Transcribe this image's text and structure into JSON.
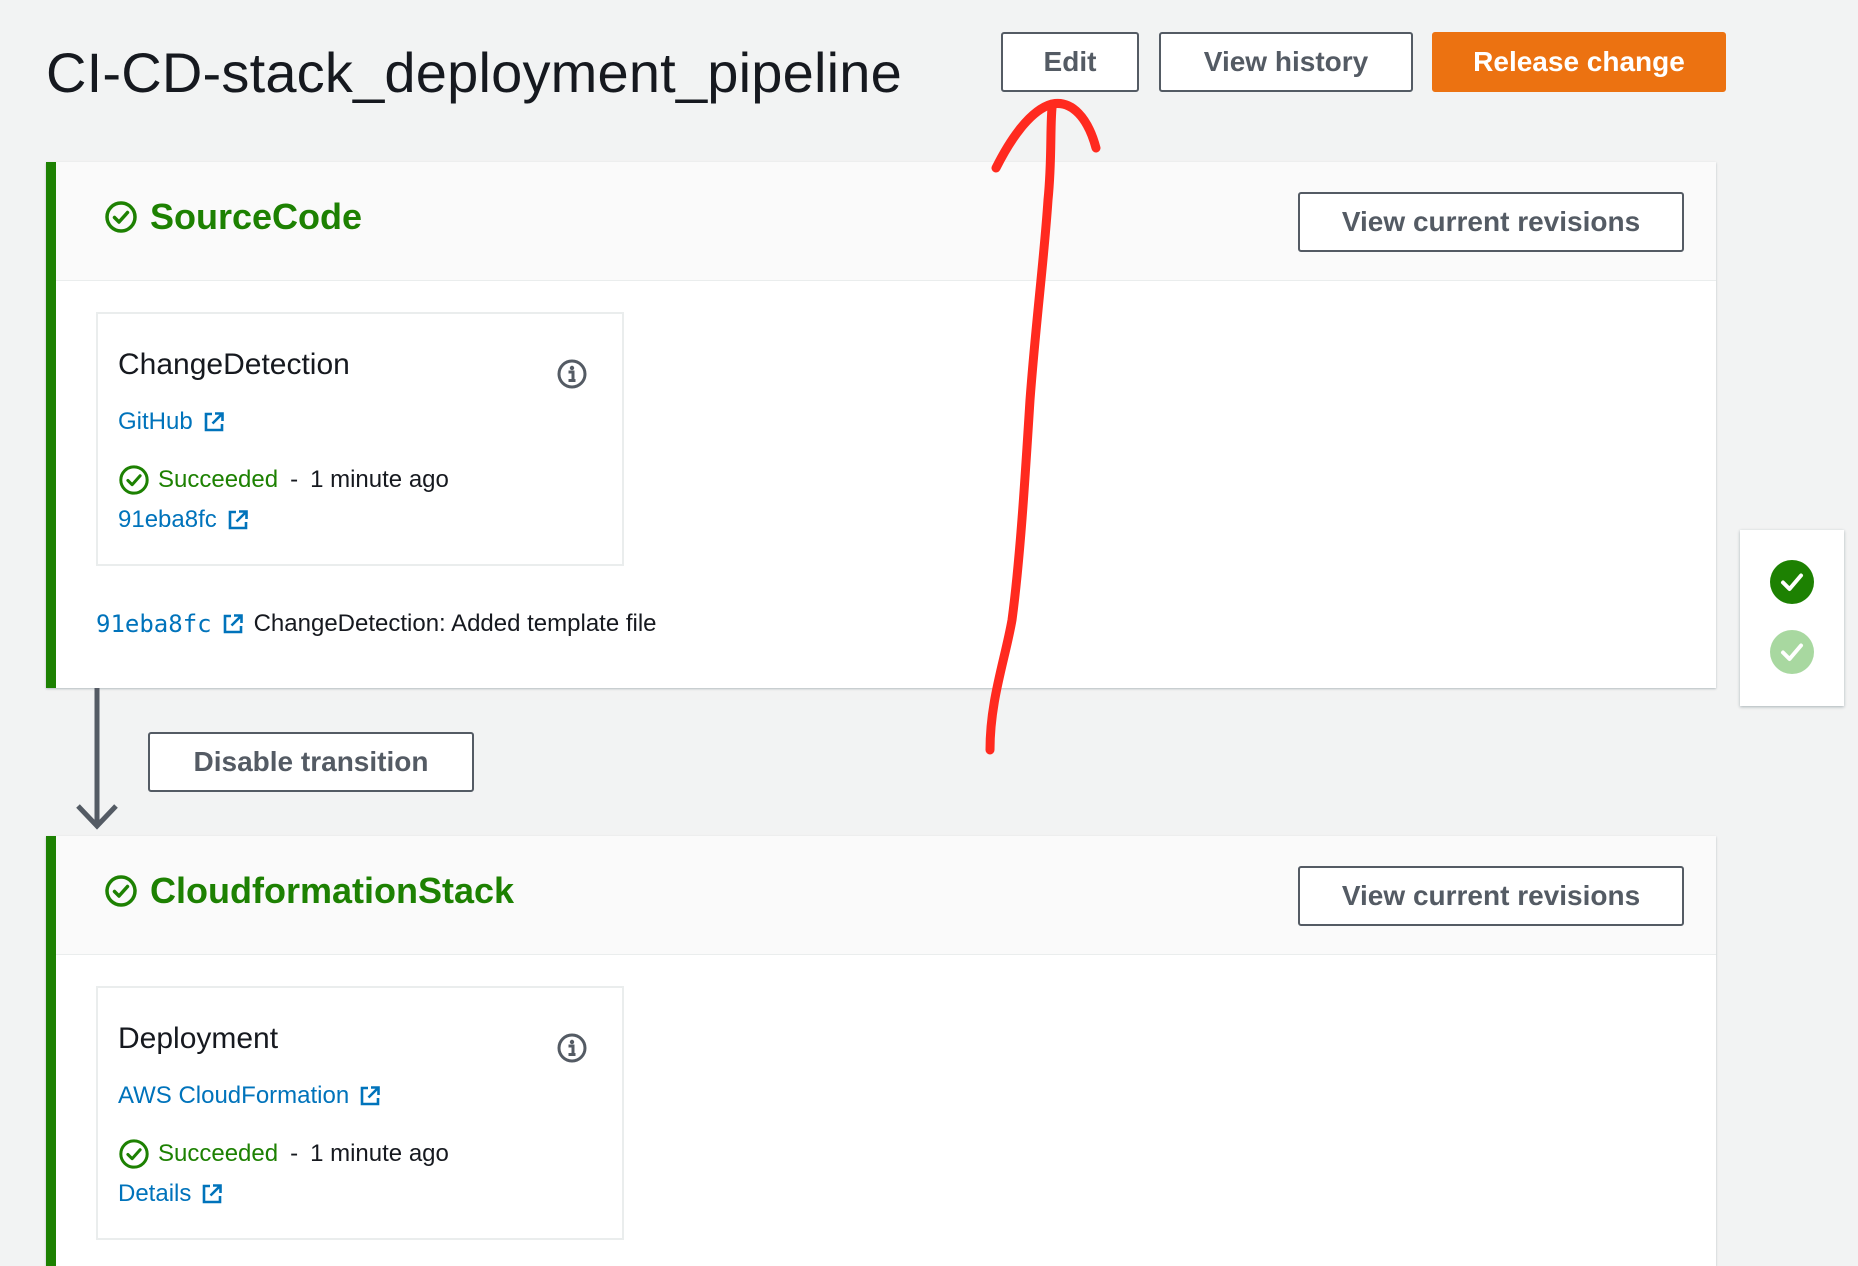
{
  "header": {
    "title": "CI-CD-stack_deployment_pipeline",
    "edit_label": "Edit",
    "view_history_label": "View history",
    "release_change_label": "Release change"
  },
  "stages": [
    {
      "name": "SourceCode",
      "view_revisions_label": "View current revisions",
      "action": {
        "name": "ChangeDetection",
        "provider": "GitHub",
        "status": "Succeeded",
        "separator": "-",
        "time": "1 minute ago",
        "link": "91eba8fc"
      },
      "revision": {
        "id": "91eba8fc",
        "message": "ChangeDetection: Added template file"
      }
    },
    {
      "name": "CloudformationStack",
      "view_revisions_label": "View current revisions",
      "action": {
        "name": "Deployment",
        "provider": "AWS CloudFormation",
        "status": "Succeeded",
        "separator": "-",
        "time": "1 minute ago",
        "link": "Details"
      }
    }
  ],
  "transition": {
    "disable_label": "Disable transition"
  },
  "colors": {
    "success": "#1d8102",
    "success_light": "#a8d8a0",
    "link": "#0073bb",
    "primary": "#ec7211",
    "annotation": "#ff2a1f"
  },
  "icons": [
    "check-circle-icon",
    "info-icon",
    "external-link-icon",
    "arrow-down-icon",
    "check-badge-icon"
  ]
}
